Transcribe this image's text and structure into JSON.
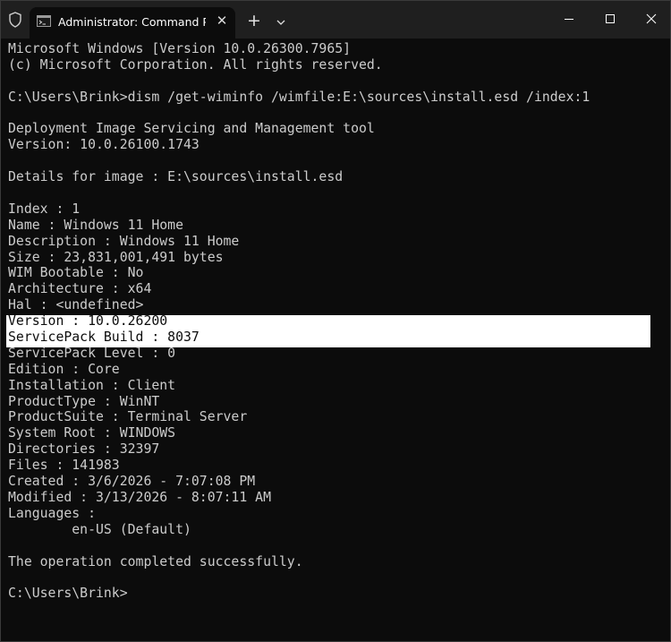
{
  "window": {
    "tab_title": "Administrator: Command Pro",
    "tab_close": "✕",
    "new_tab": "+",
    "icons": {
      "shield": "shield-icon",
      "tab": "terminal-icon",
      "dropdown": "chevron-down-icon",
      "minimize": "minimize-icon",
      "maximize": "maximize-icon",
      "close": "close-icon"
    },
    "colors": {
      "background": "#0c0c0c",
      "titlebar": "#1f1f1f",
      "text": "#cccccc",
      "highlight": "#ffffff"
    }
  },
  "terminal": {
    "lines": [
      "Microsoft Windows [Version 10.0.26300.7965]",
      "(c) Microsoft Corporation. All rights reserved.",
      "",
      "C:\\Users\\Brink>dism /get-wiminfo /wimfile:E:\\sources\\install.esd /index:1",
      "",
      "Deployment Image Servicing and Management tool",
      "Version: 10.0.26100.1743",
      "",
      "Details for image : E:\\sources\\install.esd",
      "",
      "Index : 1",
      "Name : Windows 11 Home",
      "Description : Windows 11 Home",
      "Size : 23,831,001,491 bytes",
      "WIM Bootable : No",
      "Architecture : x64",
      "Hal : <undefined>",
      "Version : 10.0.26200",
      "ServicePack Build : 8037",
      "ServicePack Level : 0",
      "Edition : Core",
      "Installation : Client",
      "ProductType : WinNT",
      "ProductSuite : Terminal Server",
      "System Root : WINDOWS",
      "Directories : 32397",
      "Files : 141983",
      "Created : 3/6/2026 - 7:07:08 PM",
      "Modified : 3/13/2026 - 8:07:11 AM",
      "Languages :",
      "        en-US (Default)",
      "",
      "The operation completed successfully.",
      "",
      "C:\\Users\\Brink>"
    ],
    "highlighted_lines": [
      17,
      18
    ]
  }
}
